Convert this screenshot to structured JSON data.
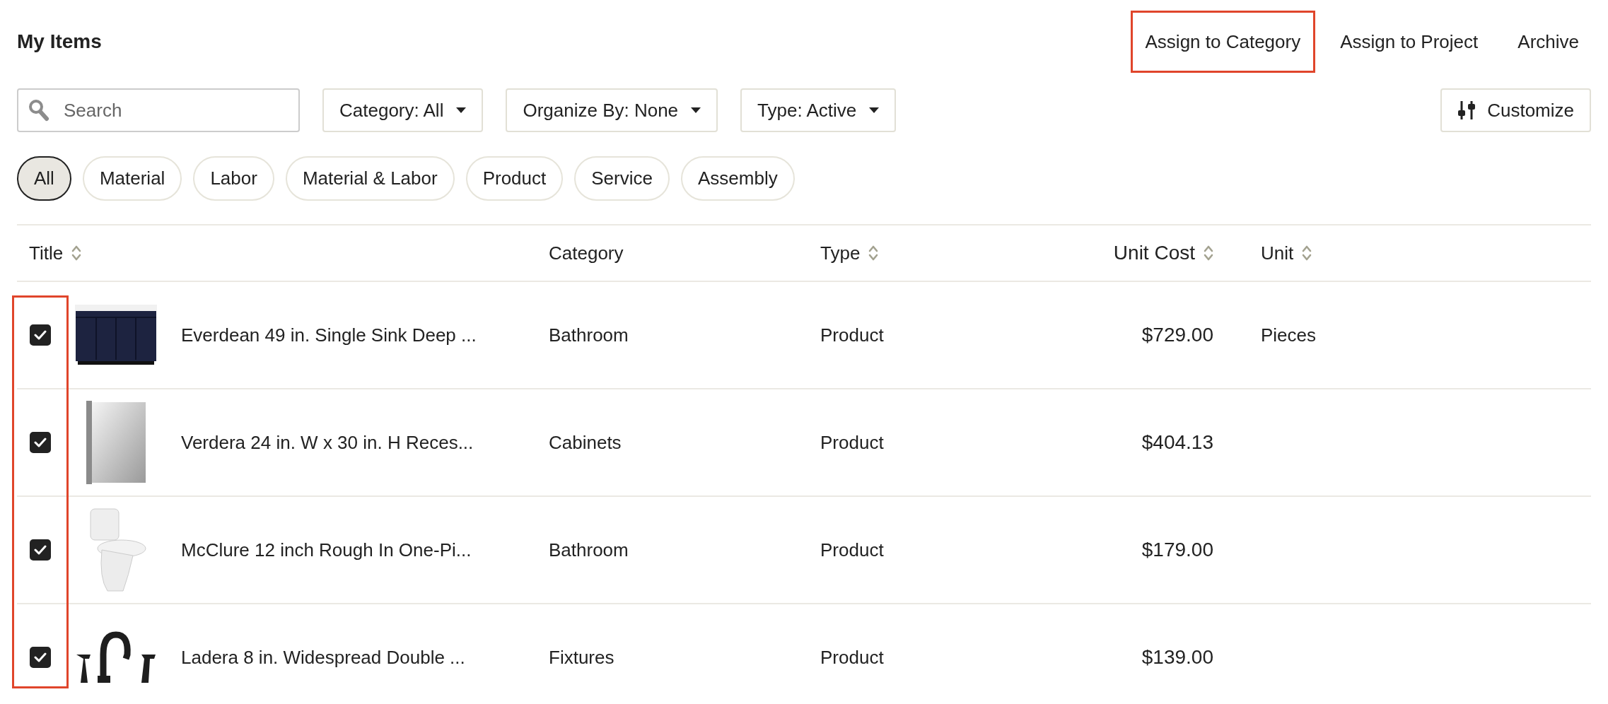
{
  "page": {
    "title": "My Items"
  },
  "actions": [
    {
      "label": "Assign to Category",
      "highlighted": true
    },
    {
      "label": "Assign to Project",
      "highlighted": false
    },
    {
      "label": "Archive",
      "highlighted": false
    }
  ],
  "search": {
    "placeholder": "Search"
  },
  "filters": [
    {
      "label": "Category: All"
    },
    {
      "label": "Organize By: None"
    },
    {
      "label": "Type: Active"
    }
  ],
  "customize": {
    "label": "Customize"
  },
  "type_chips": [
    {
      "label": "All",
      "selected": true
    },
    {
      "label": "Material",
      "selected": false
    },
    {
      "label": "Labor",
      "selected": false
    },
    {
      "label": "Material & Labor",
      "selected": false
    },
    {
      "label": "Product",
      "selected": false
    },
    {
      "label": "Service",
      "selected": false
    },
    {
      "label": "Assembly",
      "selected": false
    }
  ],
  "table": {
    "checkbox_column_highlighted": true,
    "columns": [
      {
        "label": "Title",
        "sortable": true
      },
      {
        "label": "Category",
        "sortable": false
      },
      {
        "label": "Type",
        "sortable": true
      },
      {
        "label": "Unit Cost",
        "sortable": true
      },
      {
        "label": "Unit",
        "sortable": true
      }
    ],
    "rows": [
      {
        "checked": true,
        "kind": "vanity",
        "title": "Everdean 49 in. Single Sink Deep ...",
        "category": "Bathroom",
        "type": "Product",
        "unit_cost": "$729.00",
        "unit": "Pieces"
      },
      {
        "checked": true,
        "kind": "cabinet",
        "title": "Verdera 24 in. W x 30 in. H Reces...",
        "category": "Cabinets",
        "type": "Product",
        "unit_cost": "$404.13"
      },
      {
        "checked": true,
        "kind": "toilet",
        "title": "McClure 12 inch Rough In One-Pi...",
        "category": "Bathroom",
        "type": "Product",
        "unit_cost": "$179.00"
      },
      {
        "checked": true,
        "kind": "faucet",
        "title": "Ladera 8 in. Widespread Double ...",
        "category": "Fixtures",
        "type": "Product",
        "unit_cost": "$139.00"
      }
    ]
  }
}
